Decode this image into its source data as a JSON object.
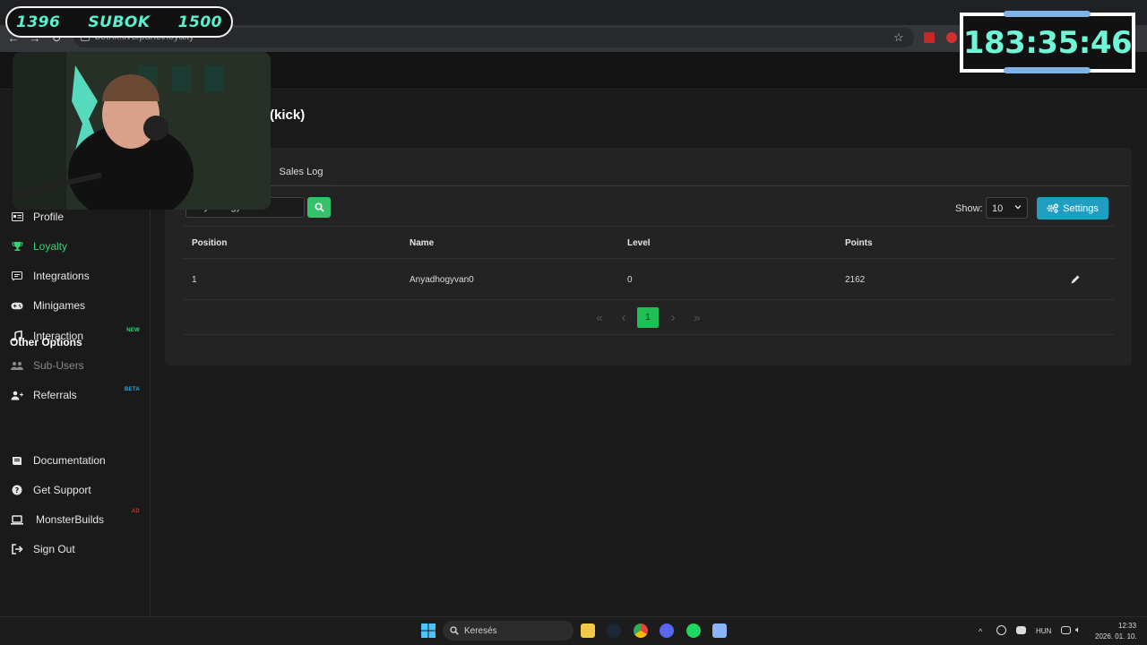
{
  "browser": {
    "url": "botrix.live/panel/loyalty"
  },
  "overlay": {
    "counter_left": "1396",
    "counter_label": "SUBOK",
    "counter_right": "1500",
    "timer": "183:35:46"
  },
  "page": {
    "title": "(kick)",
    "tabs": [
      "Sales Log"
    ],
    "search_value": "Anyadhogyvan0",
    "show_label": "Show:",
    "show_value": "10",
    "settings_label": "Settings"
  },
  "sidebar": {
    "items": [
      {
        "label": "Profile",
        "icon": "id-card-icon"
      },
      {
        "label": "Loyalty",
        "icon": "trophy-icon",
        "active": true
      },
      {
        "label": "Integrations",
        "icon": "integrations-icon"
      },
      {
        "label": "Minigames",
        "icon": "gamepad-icon"
      },
      {
        "label": "Interaction",
        "icon": "music-icon",
        "badge": "NEW",
        "badge_color": "#3bd16f"
      },
      {
        "label": "Sub-Users",
        "icon": "users-icon",
        "dim": true
      },
      {
        "label": "Referrals",
        "icon": "referral-icon",
        "badge": "BETA",
        "badge_color": "#2ba8d4"
      }
    ],
    "other_heading": "Other Options",
    "other_items": [
      {
        "label": "Documentation",
        "icon": "book-icon"
      },
      {
        "label": "Get Support",
        "icon": "question-icon"
      },
      {
        "label": "MonsterBuilds",
        "icon": "laptop-icon",
        "badge": "AD",
        "badge_color": "#c0392b"
      },
      {
        "label": "Sign Out",
        "icon": "sign-out-icon"
      }
    ]
  },
  "table": {
    "headers": [
      "Position",
      "Name",
      "Level",
      "Points"
    ],
    "rows": [
      {
        "position": "1",
        "name": "Anyadhogyvan0",
        "level": "0",
        "points": "2162"
      }
    ]
  },
  "pagination": {
    "first": "«",
    "prev": "‹",
    "current": "1",
    "next": "›",
    "last": "»"
  },
  "taskbar": {
    "search_label": "Keresés",
    "language": "HUN",
    "time": "12:33",
    "date": "2026. 01. 10."
  },
  "colors": {
    "accent_green": "#3bd16f",
    "settings_blue": "#1e9fc1",
    "overlay_cyan": "#57f3d0"
  }
}
